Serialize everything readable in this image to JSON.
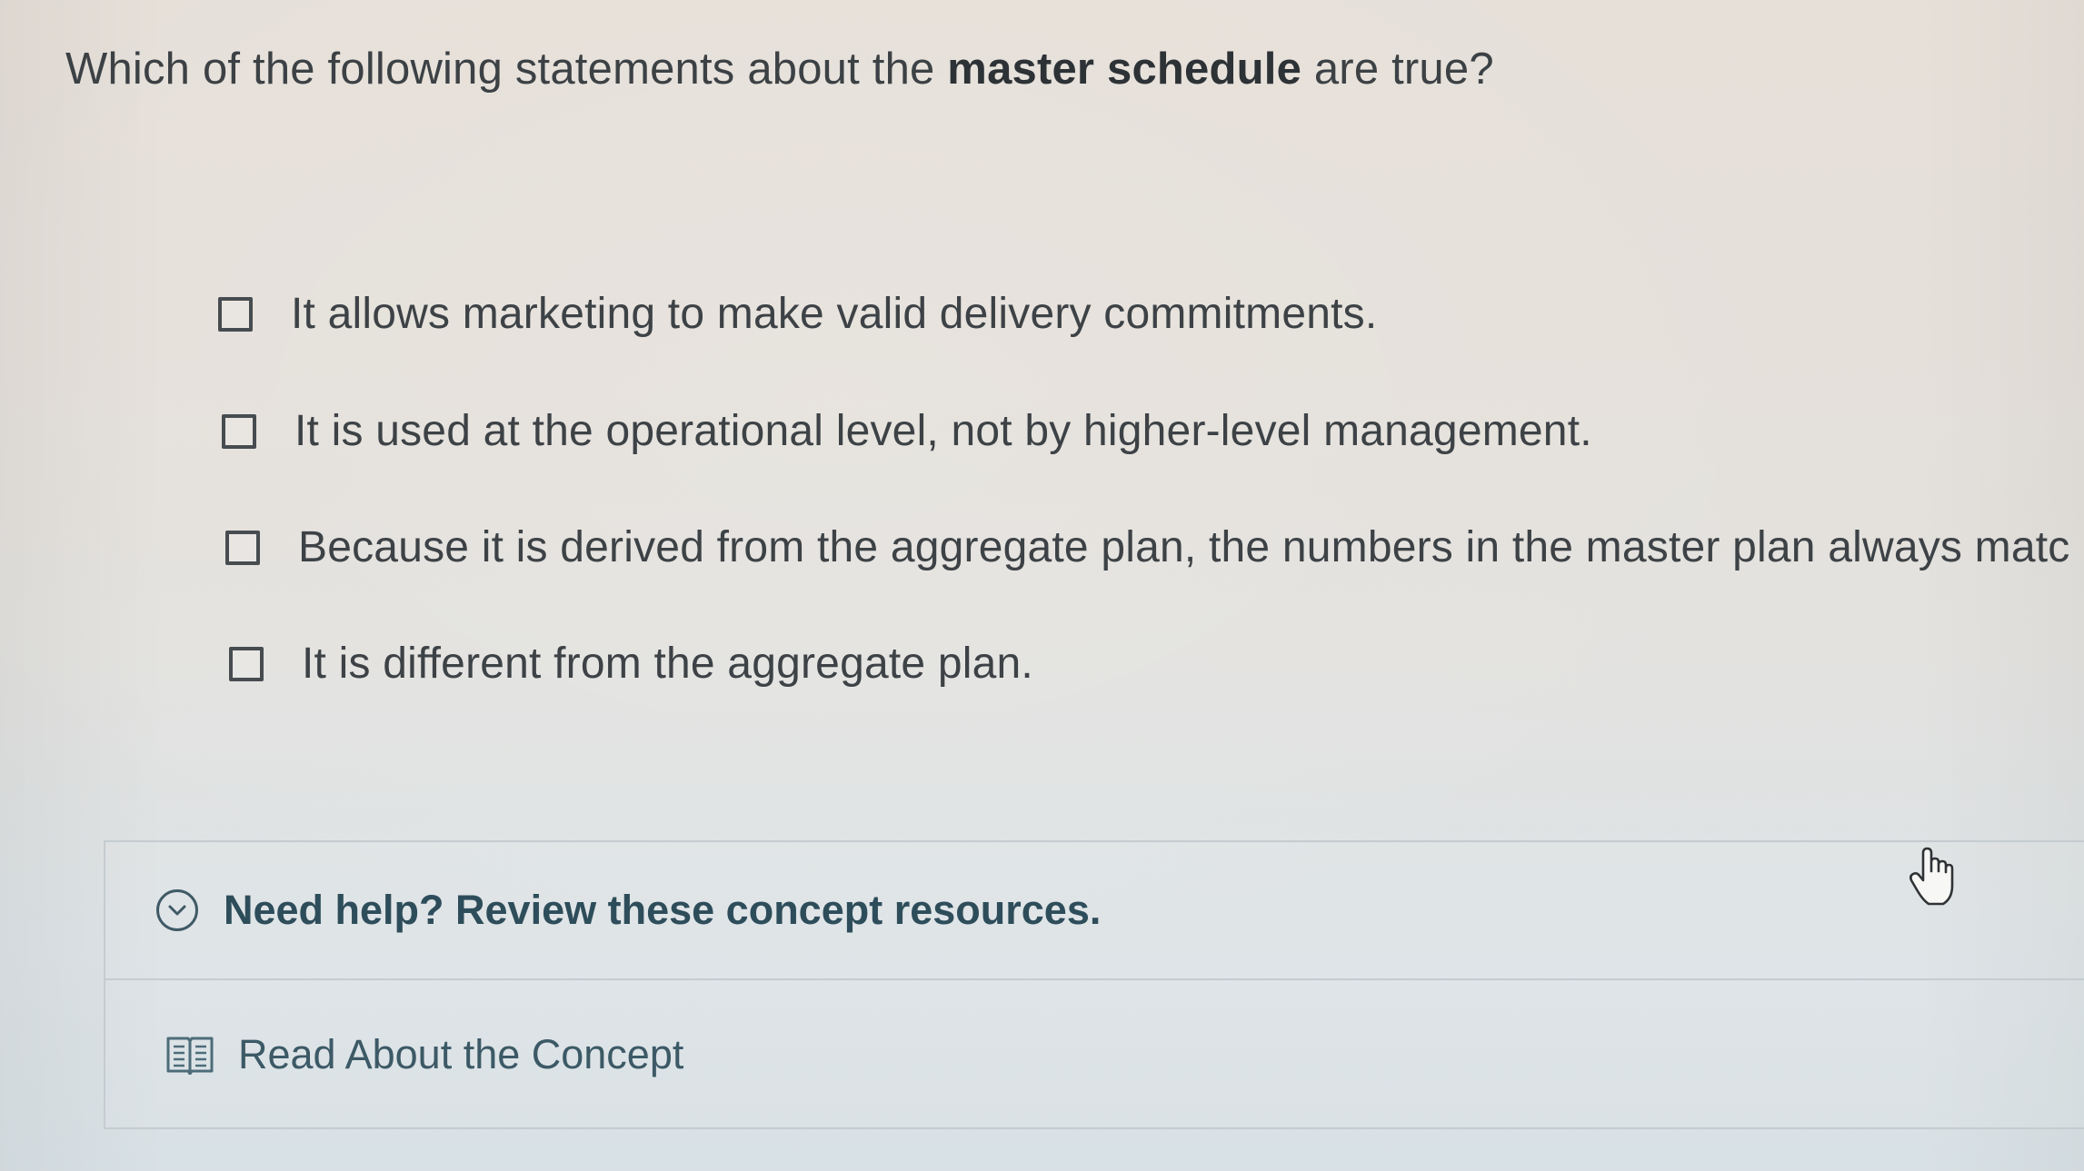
{
  "question": {
    "prefix": "Which of the following statements about the ",
    "bold": "master schedule",
    "suffix": " are true?"
  },
  "options": [
    {
      "label": "It allows marketing to make valid delivery commitments.",
      "checked": false
    },
    {
      "label": "It is used at the operational level, not by higher-level management.",
      "checked": false
    },
    {
      "label": "Because it is derived from the aggregate plan, the numbers in the master plan always matc",
      "checked": false
    },
    {
      "label": "It is different from the aggregate plan.",
      "checked": false
    }
  ],
  "help": {
    "title": "Need help? Review these concept resources.",
    "toggle_icon": "chevron-down-circle-icon",
    "resources": [
      {
        "label": "Read About the Concept",
        "icon": "book-icon"
      }
    ]
  },
  "cursor": {
    "icon": "hand-pointer-icon"
  },
  "colors": {
    "text": "#3d4246",
    "help_title": "#2e4d5b",
    "resource_link": "#3c5966",
    "border": "#c5ccd0"
  }
}
